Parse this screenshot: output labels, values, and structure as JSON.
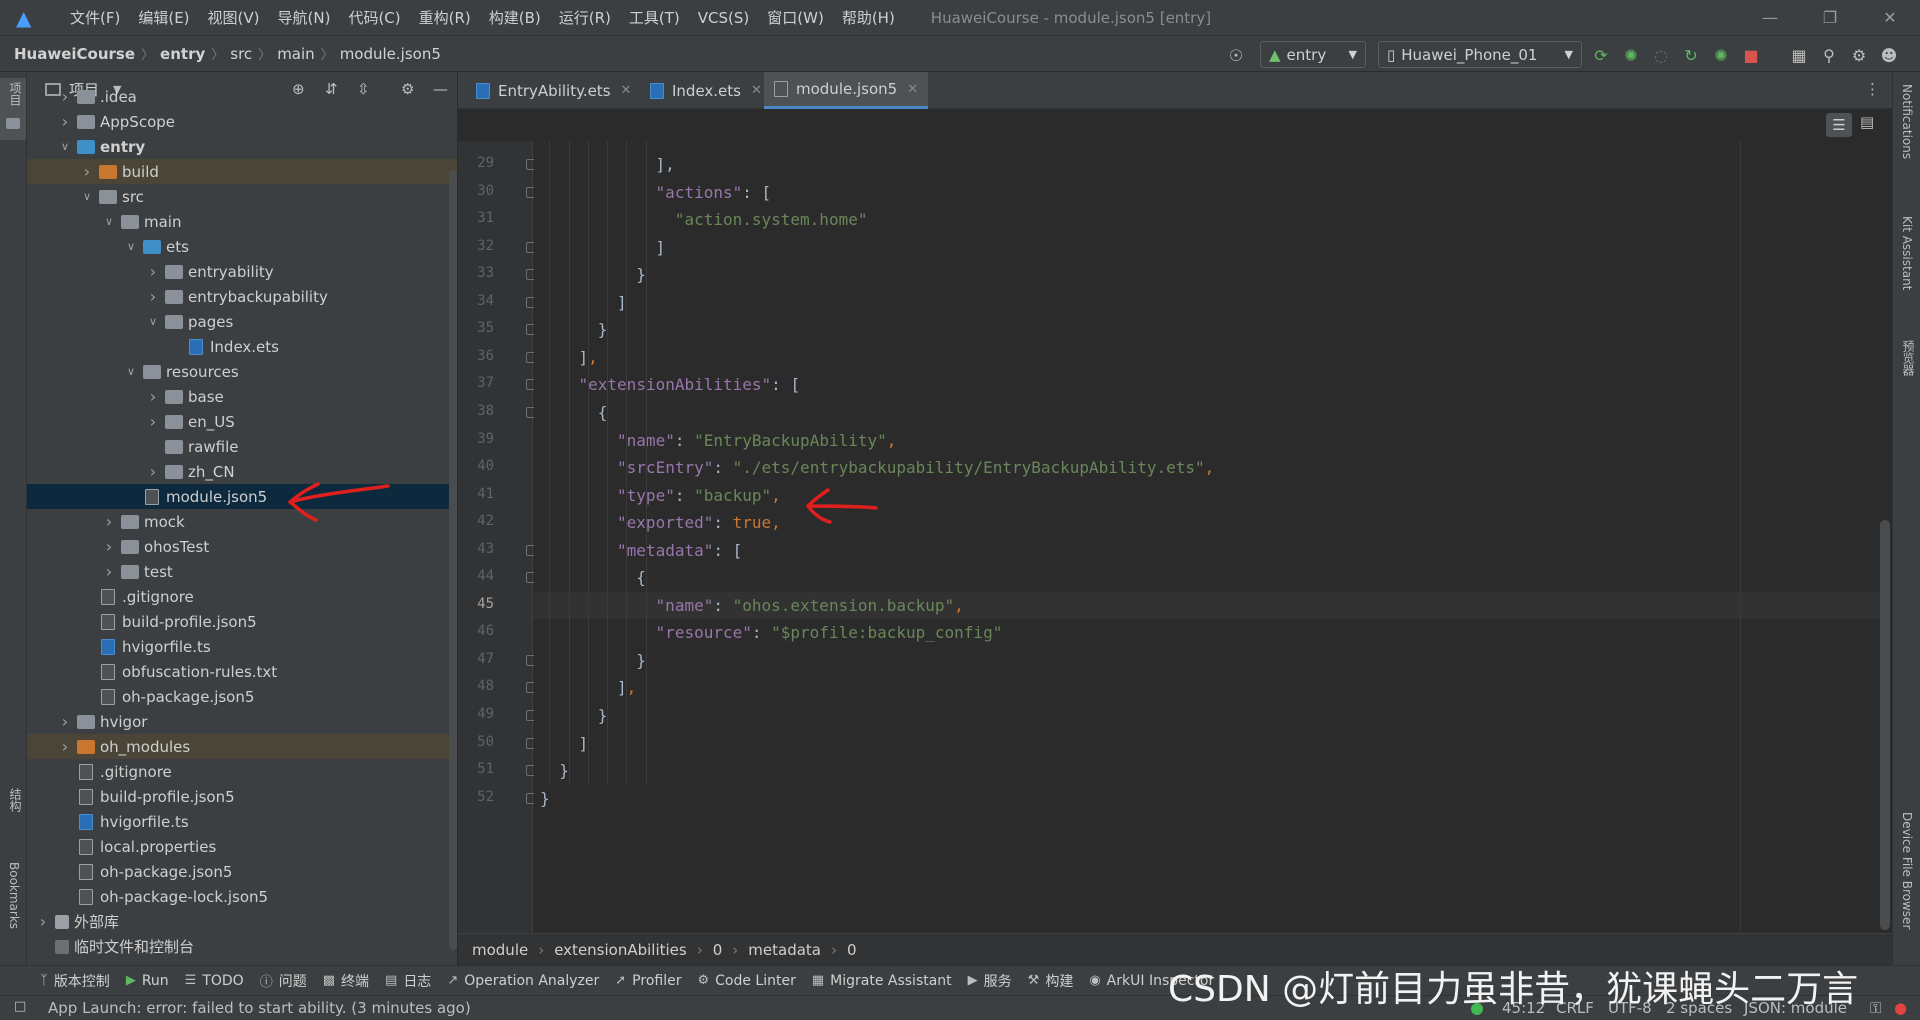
{
  "menubar": {
    "items": [
      "文件(F)",
      "编辑(E)",
      "视图(V)",
      "导航(N)",
      "代码(C)",
      "重构(R)",
      "构建(B)",
      "运行(R)",
      "工具(T)",
      "VCS(S)",
      "窗口(W)",
      "帮助(H)"
    ],
    "window_title": "HuaweiCourse - module.json5 [entry]"
  },
  "navbar": {
    "breadcrumbs": [
      "HuaweiCourse",
      "entry",
      "src",
      "main",
      "module.json5"
    ],
    "run_config": "entry",
    "device": "Huawei_Phone_01"
  },
  "project_panel": {
    "title": "项目",
    "tree": [
      {
        "label": ".idea",
        "type": "folder",
        "depth": 1,
        "expanded": false
      },
      {
        "label": "AppScope",
        "type": "folder",
        "depth": 1,
        "expanded": false
      },
      {
        "label": "entry",
        "type": "folder-blue",
        "depth": 1,
        "expanded": true,
        "bold": true
      },
      {
        "label": "build",
        "type": "folder-orange",
        "depth": 2,
        "expanded": false,
        "state": "excluded"
      },
      {
        "label": "src",
        "type": "folder",
        "depth": 2,
        "expanded": true
      },
      {
        "label": "main",
        "type": "folder",
        "depth": 3,
        "expanded": true
      },
      {
        "label": "ets",
        "type": "folder-blue",
        "depth": 4,
        "expanded": true
      },
      {
        "label": "entryability",
        "type": "folder",
        "depth": 5,
        "expanded": false
      },
      {
        "label": "entrybackupability",
        "type": "folder",
        "depth": 5,
        "expanded": false
      },
      {
        "label": "pages",
        "type": "folder",
        "depth": 5,
        "expanded": true
      },
      {
        "label": "Index.ets",
        "type": "file-ts",
        "depth": 6
      },
      {
        "label": "resources",
        "type": "folder",
        "depth": 4,
        "expanded": true
      },
      {
        "label": "base",
        "type": "folder",
        "depth": 5,
        "expanded": false
      },
      {
        "label": "en_US",
        "type": "folder",
        "depth": 5,
        "expanded": false
      },
      {
        "label": "rawfile",
        "type": "folder",
        "depth": 5
      },
      {
        "label": "zh_CN",
        "type": "folder",
        "depth": 5,
        "expanded": false
      },
      {
        "label": "module.json5",
        "type": "file",
        "depth": 4,
        "state": "selected"
      },
      {
        "label": "mock",
        "type": "folder",
        "depth": 3,
        "expanded": false
      },
      {
        "label": "ohosTest",
        "type": "folder",
        "depth": 3,
        "expanded": false
      },
      {
        "label": "test",
        "type": "folder",
        "depth": 3,
        "expanded": false
      },
      {
        "label": ".gitignore",
        "type": "file",
        "depth": 2
      },
      {
        "label": "build-profile.json5",
        "type": "file",
        "depth": 2
      },
      {
        "label": "hvigorfile.ts",
        "type": "file-ts",
        "depth": 2
      },
      {
        "label": "obfuscation-rules.txt",
        "type": "file",
        "depth": 2
      },
      {
        "label": "oh-package.json5",
        "type": "file",
        "depth": 2
      },
      {
        "label": "hvigor",
        "type": "folder",
        "depth": 1,
        "expanded": false
      },
      {
        "label": "oh_modules",
        "type": "folder-orange",
        "depth": 1,
        "expanded": false,
        "state": "excluded"
      },
      {
        "label": ".gitignore",
        "type": "file",
        "depth": 1
      },
      {
        "label": "build-profile.json5",
        "type": "file",
        "depth": 1
      },
      {
        "label": "hvigorfile.ts",
        "type": "file-ts",
        "depth": 1
      },
      {
        "label": "local.properties",
        "type": "file",
        "depth": 1
      },
      {
        "label": "oh-package.json5",
        "type": "file",
        "depth": 1
      },
      {
        "label": "oh-package-lock.json5",
        "type": "file",
        "depth": 1
      },
      {
        "label": "外部库",
        "type": "library",
        "depth": 0,
        "expanded": false
      },
      {
        "label": "临时文件和控制台",
        "type": "scratch",
        "depth": 0
      }
    ]
  },
  "tabs": [
    {
      "label": "EntryAbility.ets",
      "active": false
    },
    {
      "label": "Index.ets",
      "active": false
    },
    {
      "label": "module.json5",
      "active": true
    }
  ],
  "editor": {
    "current_line": 45,
    "lines": [
      {
        "n": 29,
        "indent": 6,
        "tokens": [
          [
            "p",
            "],"
          ]
        ]
      },
      {
        "n": 30,
        "indent": 6,
        "tokens": [
          [
            "k",
            "\"actions\""
          ],
          [
            "p",
            ": ["
          ]
        ]
      },
      {
        "n": 31,
        "indent": 7,
        "tokens": [
          [
            "s",
            "\"action.system.home\""
          ]
        ]
      },
      {
        "n": 32,
        "indent": 6,
        "tokens": [
          [
            "p",
            "]"
          ]
        ]
      },
      {
        "n": 33,
        "indent": 5,
        "tokens": [
          [
            "p",
            "}"
          ]
        ]
      },
      {
        "n": 34,
        "indent": 4,
        "tokens": [
          [
            "p",
            "]"
          ]
        ]
      },
      {
        "n": 35,
        "indent": 3,
        "tokens": [
          [
            "p",
            "}"
          ]
        ]
      },
      {
        "n": 36,
        "indent": 2,
        "tokens": [
          [
            "p",
            "]"
          ],
          [
            "c",
            ","
          ]
        ]
      },
      {
        "n": 37,
        "indent": 2,
        "tokens": [
          [
            "k",
            "\"extensionAbilities\""
          ],
          [
            "p",
            ": ["
          ]
        ]
      },
      {
        "n": 38,
        "indent": 3,
        "tokens": [
          [
            "p",
            "{"
          ]
        ]
      },
      {
        "n": 39,
        "indent": 4,
        "tokens": [
          [
            "k",
            "\"name\""
          ],
          [
            "p",
            ": "
          ],
          [
            "s",
            "\"EntryBackupAbility\""
          ],
          [
            "c",
            ","
          ]
        ]
      },
      {
        "n": 40,
        "indent": 4,
        "tokens": [
          [
            "k",
            "\"srcEntry\""
          ],
          [
            "p",
            ": "
          ],
          [
            "s",
            "\"./ets/entrybackupability/EntryBackupAbility.ets\""
          ],
          [
            "c",
            ","
          ]
        ]
      },
      {
        "n": 41,
        "indent": 4,
        "tokens": [
          [
            "k",
            "\"type\""
          ],
          [
            "p",
            ": "
          ],
          [
            "s",
            "\"backup\""
          ],
          [
            "c",
            ","
          ]
        ]
      },
      {
        "n": 42,
        "indent": 4,
        "tokens": [
          [
            "k",
            "\"exported\""
          ],
          [
            "p",
            ": "
          ],
          [
            "b",
            "true"
          ],
          [
            "c",
            ","
          ]
        ]
      },
      {
        "n": 43,
        "indent": 4,
        "tokens": [
          [
            "k",
            "\"metadata\""
          ],
          [
            "p",
            ": ["
          ]
        ]
      },
      {
        "n": 44,
        "indent": 5,
        "tokens": [
          [
            "p",
            "{"
          ]
        ]
      },
      {
        "n": 45,
        "indent": 6,
        "tokens": [
          [
            "k",
            "\"name\""
          ],
          [
            "p",
            ": "
          ],
          [
            "s",
            "\"ohos.extension.backup\""
          ],
          [
            "c",
            ","
          ]
        ]
      },
      {
        "n": 46,
        "indent": 6,
        "tokens": [
          [
            "k",
            "\"resource\""
          ],
          [
            "p",
            ": "
          ],
          [
            "s",
            "\"$profile:backup_config\""
          ]
        ]
      },
      {
        "n": 47,
        "indent": 5,
        "tokens": [
          [
            "p",
            "}"
          ]
        ]
      },
      {
        "n": 48,
        "indent": 4,
        "tokens": [
          [
            "p",
            "]"
          ],
          [
            "c",
            ","
          ]
        ]
      },
      {
        "n": 49,
        "indent": 3,
        "tokens": [
          [
            "p",
            "}"
          ]
        ]
      },
      {
        "n": 50,
        "indent": 2,
        "tokens": [
          [
            "p",
            "]"
          ]
        ]
      },
      {
        "n": 51,
        "indent": 1,
        "tokens": [
          [
            "p",
            "}"
          ]
        ]
      },
      {
        "n": 52,
        "indent": 0,
        "tokens": [
          [
            "p",
            "}"
          ]
        ]
      }
    ]
  },
  "editor_breadcrumbs": [
    "module",
    "extensionAbilities",
    "0",
    "metadata",
    "0"
  ],
  "left_strip": {
    "project": "项目",
    "structure": "结构",
    "bookmarks": "Bookmarks"
  },
  "right_strip": {
    "notifications": "Notifications",
    "kit_assistant": "Kit Assistant",
    "previewer": "预览器",
    "device_file_browser": "Device File Browser"
  },
  "bottom_tools": [
    "版本控制",
    "Run",
    "TODO",
    "问题",
    "终端",
    "日志",
    "Operation Analyzer",
    "Profiler",
    "Code Linter",
    "Migrate Assistant",
    "服务",
    "构建",
    "ArkUI Inspector"
  ],
  "statusbar": {
    "message": "App Launch: error: failed to start ability. (3 minutes ago)",
    "position": "45:12",
    "line_sep": "CRLF",
    "encoding": "UTF-8",
    "indent": "2 spaces",
    "schema": "JSON: module"
  },
  "watermark": "CSDN @灯前目力虽非昔，犹课蝇头二万言",
  "colors": {
    "annotation_arrow": "#e0201c",
    "selection": "#0d293e",
    "keyword": "#9876aa",
    "string": "#6a8759",
    "boolean": "#cc7832"
  }
}
